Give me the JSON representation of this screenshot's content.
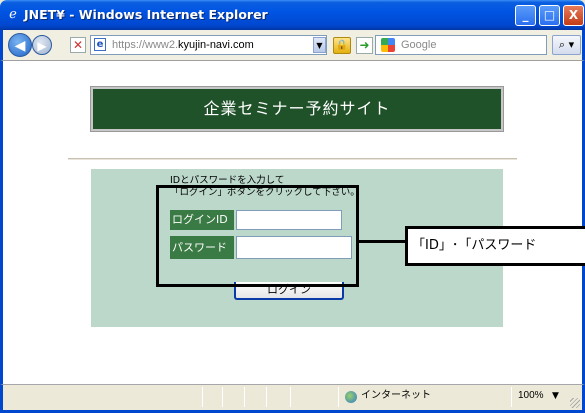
{
  "window": {
    "title": "JNET¥ - Windows Internet Explorer",
    "minimize_label": "_",
    "maximize_label": "□",
    "close_label": "X"
  },
  "addressbar": {
    "url_dim_prefix": "https://www2.",
    "url_host": "kyujin-navi.com",
    "search_placeholder": "Google"
  },
  "page": {
    "banner_title": "企業セミナー予約サイト",
    "instruction_line1": "IDとパスワードを入力して",
    "instruction_line2": "「ログイン」ボタンをクリックして下さい。",
    "id_label": "ログインID",
    "password_label": "パスワード",
    "id_value": "",
    "password_value": "",
    "login_button": "ログイン"
  },
  "annotation": {
    "callout_text": "「ID」･「パスワード"
  },
  "statusbar": {
    "zone": "インターネット",
    "zoom": "100%"
  },
  "colors": {
    "banner_bg": "#1f5228",
    "panel_bg": "#bcd8cb",
    "label_bg": "#3a7a44",
    "titlebar": "#0054e3"
  }
}
